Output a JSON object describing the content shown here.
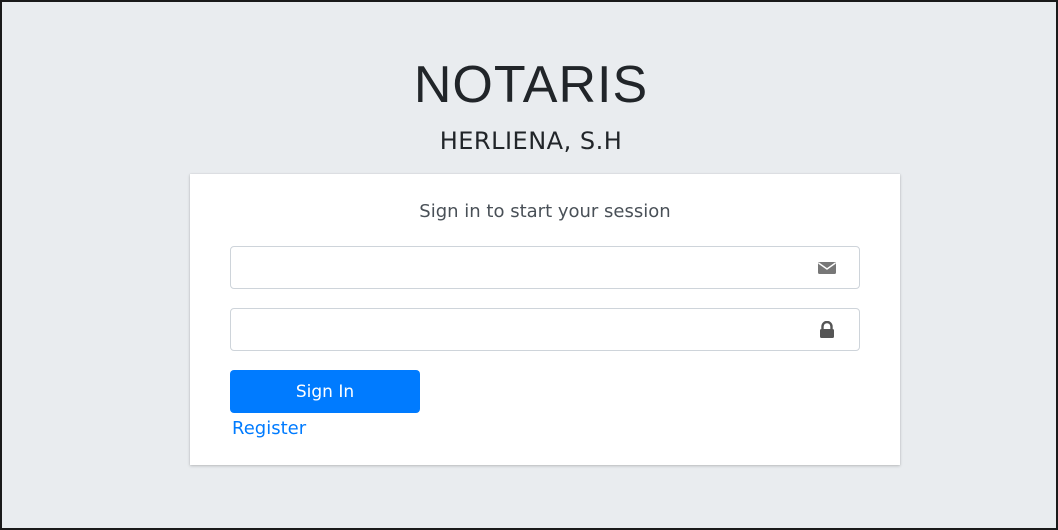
{
  "brand": {
    "title": "NOTARIS",
    "subtitle": "HERLIENA, S.H"
  },
  "login": {
    "message": "Sign in to start your session",
    "email": {
      "value": "",
      "placeholder": "",
      "icon": "envelope-icon"
    },
    "password": {
      "value": "",
      "placeholder": "",
      "icon": "lock-icon"
    },
    "submit_label": "Sign In",
    "register_label": "Register"
  },
  "colors": {
    "background": "#e9ecef",
    "card": "#ffffff",
    "primary": "#007bff",
    "text": "#212529",
    "icon": "#777777"
  }
}
